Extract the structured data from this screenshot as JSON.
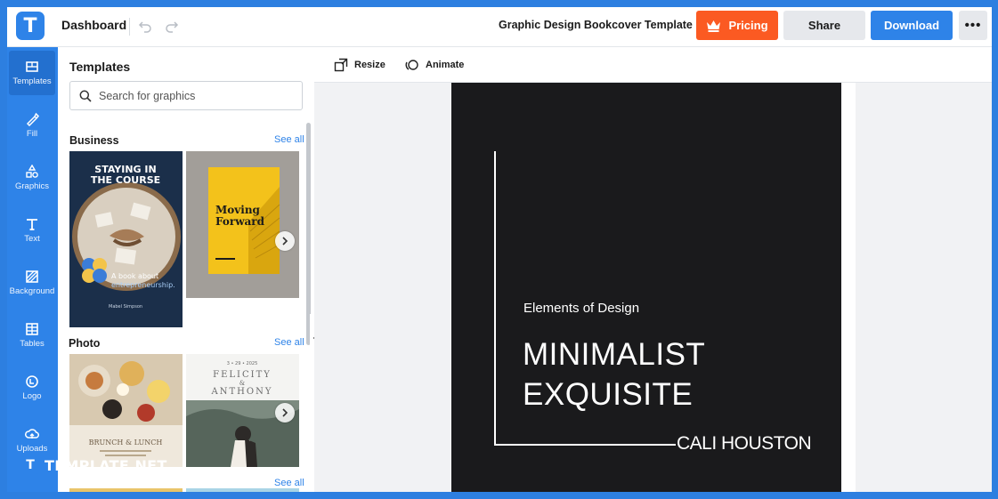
{
  "header": {
    "logo_letter": "T",
    "title": "Dashboard",
    "doc_title": "Graphic Design Bookcover Template",
    "pricing_label": "Pricing",
    "share_label": "Share",
    "download_label": "Download",
    "more_label": "•••"
  },
  "rail": {
    "items": [
      {
        "label": "Templates",
        "icon": "templates-icon"
      },
      {
        "label": "Fill",
        "icon": "fill-icon"
      },
      {
        "label": "Graphics",
        "icon": "graphics-icon"
      },
      {
        "label": "Text",
        "icon": "text-icon"
      },
      {
        "label": "Background",
        "icon": "background-icon"
      },
      {
        "label": "Tables",
        "icon": "tables-icon"
      },
      {
        "label": "Logo",
        "icon": "logo-icon"
      },
      {
        "label": "Uploads",
        "icon": "uploads-icon"
      }
    ]
  },
  "panel": {
    "title": "Templates",
    "search_placeholder": "Search for graphics",
    "sections": [
      {
        "title": "Business",
        "see_all": "See all",
        "thumbs": [
          {
            "title": "STAYING IN\nTHE COURSE",
            "tagline": "A book about\nentrepreneurship.",
            "author": "Mabel Simpson"
          },
          {
            "title": "Moving\nForward"
          }
        ]
      },
      {
        "title": "Photo",
        "see_all": "See all",
        "thumbs": [
          {
            "title": "BRUNCH & LUNCH"
          },
          {
            "date": "3 • 29 • 2025",
            "title1": "FELICITY",
            "amp": "&",
            "title2": "ANTHONY"
          }
        ]
      },
      {
        "title": "",
        "see_all": "See all"
      }
    ]
  },
  "toolbar": {
    "resize_label": "Resize",
    "animate_label": "Animate"
  },
  "cover": {
    "subtitle": "Elements of Design",
    "line1": "MINIMALIST",
    "line2": "EXQUISITE",
    "author": "CALI HOUSTON"
  },
  "watermark": {
    "badge": "T",
    "text": "TEMPLATE.NET"
  },
  "colors": {
    "accent": "#2e83e8",
    "pricing": "#fb5a22",
    "cover_bg": "#1a1a1c"
  }
}
